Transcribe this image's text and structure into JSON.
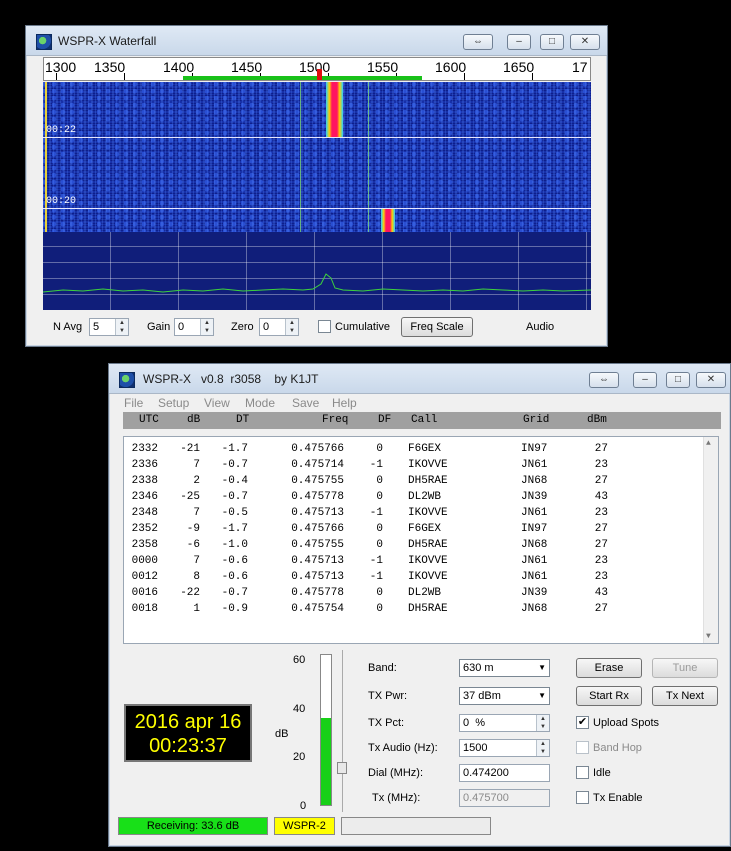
{
  "waterfall": {
    "title": "WSPR-X Waterfall",
    "scale_labels": [
      "1300",
      "1350",
      "1400",
      "1450",
      "1500",
      "1550",
      "1600",
      "1650",
      "17"
    ],
    "time_labels": [
      "00:22",
      "00:20"
    ],
    "controls": {
      "navg_label": "N Avg",
      "navg_value": "5",
      "gain_label": "Gain",
      "gain_value": "0",
      "zero_label": "Zero",
      "zero_value": "0",
      "cumulative_label": "Cumulative",
      "freq_scale_button": "Freq Scale",
      "audio_label": "Audio"
    },
    "title_buttons": {
      "swap": "⇔",
      "minimize": "–",
      "maximize": "□",
      "close": "✕"
    }
  },
  "main": {
    "title": "WSPR-X   v0.8  r3058    by K1JT",
    "menu": [
      "File",
      "Setup",
      "View",
      "Mode",
      "Save",
      "Help"
    ],
    "columns": [
      "UTC",
      "dB",
      "DT",
      "Freq",
      "DF",
      "Call",
      "Grid",
      "dBm"
    ],
    "rows": [
      {
        "utc": "2332",
        "db": "-21",
        "dt": "-1.7",
        "freq": "0.475766",
        "df": "0",
        "call": "F6GEX",
        "grid": "IN97",
        "dbm": "27"
      },
      {
        "utc": "2336",
        "db": "7",
        "dt": "-0.7",
        "freq": "0.475714",
        "df": "-1",
        "call": "IKOVVE",
        "grid": "JN61",
        "dbm": "23"
      },
      {
        "utc": "2338",
        "db": "2",
        "dt": "-0.4",
        "freq": "0.475755",
        "df": "0",
        "call": "DH5RAE",
        "grid": "JN68",
        "dbm": "27"
      },
      {
        "utc": "2346",
        "db": "-25",
        "dt": "-0.7",
        "freq": "0.475778",
        "df": "0",
        "call": "DL2WB",
        "grid": "JN39",
        "dbm": "43"
      },
      {
        "utc": "2348",
        "db": "7",
        "dt": "-0.5",
        "freq": "0.475713",
        "df": "-1",
        "call": "IKOVVE",
        "grid": "JN61",
        "dbm": "23"
      },
      {
        "utc": "2352",
        "db": "-9",
        "dt": "-1.7",
        "freq": "0.475766",
        "df": "0",
        "call": "F6GEX",
        "grid": "IN97",
        "dbm": "27"
      },
      {
        "utc": "2358",
        "db": "-6",
        "dt": "-1.0",
        "freq": "0.475755",
        "df": "0",
        "call": "DH5RAE",
        "grid": "JN68",
        "dbm": "27"
      },
      {
        "utc": "0000",
        "db": "7",
        "dt": "-0.6",
        "freq": "0.475713",
        "df": "-1",
        "call": "IKOVVE",
        "grid": "JN61",
        "dbm": "23"
      },
      {
        "utc": "0012",
        "db": "8",
        "dt": "-0.6",
        "freq": "0.475713",
        "df": "-1",
        "call": "IKOVVE",
        "grid": "JN61",
        "dbm": "23"
      },
      {
        "utc": "0016",
        "db": "-22",
        "dt": "-0.7",
        "freq": "0.475778",
        "df": "0",
        "call": "DL2WB",
        "grid": "JN39",
        "dbm": "43"
      },
      {
        "utc": "0018",
        "db": "1",
        "dt": "-0.9",
        "freq": "0.475754",
        "df": "0",
        "call": "DH5RAE",
        "grid": "JN68",
        "dbm": "27"
      }
    ],
    "clock": {
      "date": "2016 apr 16",
      "time": "00:23:37"
    },
    "meter": {
      "labels": [
        "60",
        "40",
        "20",
        "0"
      ],
      "unit": "dB",
      "level_fraction": 0.58
    },
    "form": {
      "band_label": "Band:",
      "band_value": "630 m",
      "txpwr_label": "TX Pwr:",
      "txpwr_value": "37 dBm",
      "txpct_label": "TX Pct:",
      "txpct_value": "0  %",
      "txaudio_label": "Tx Audio (Hz):",
      "txaudio_value": "1500",
      "dial_label": "Dial (MHz):",
      "dial_value": "0.474200",
      "tx_label": "Tx (MHz):",
      "tx_value": "0.475700"
    },
    "buttons": {
      "erase": "Erase",
      "tune": "Tune",
      "start_rx": "Start Rx",
      "tx_next": "Tx Next"
    },
    "checks": {
      "upload_spots": "Upload Spots",
      "band_hop": "Band Hop",
      "idle": "Idle",
      "tx_enable": "Tx Enable"
    },
    "status": {
      "receiving": "Receiving:  33.6 dB",
      "mode": "WSPR-2"
    },
    "title_buttons": {
      "swap": "⇔",
      "minimize": "–",
      "maximize": "□",
      "close": "✕"
    }
  }
}
